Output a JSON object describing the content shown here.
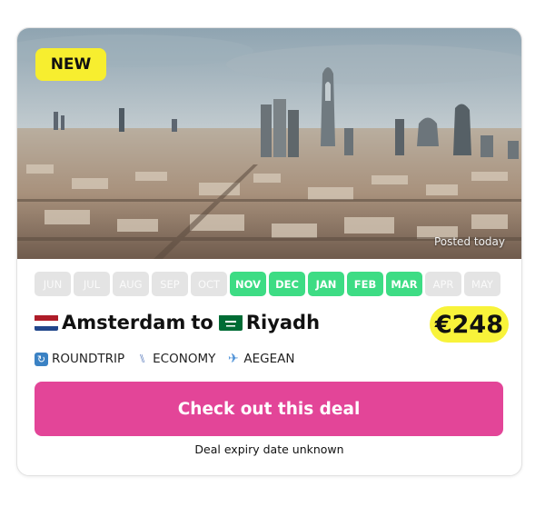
{
  "badge": "NEW",
  "posted": "Posted today",
  "months": [
    {
      "label": "JUN",
      "active": false
    },
    {
      "label": "JUL",
      "active": false
    },
    {
      "label": "AUG",
      "active": false
    },
    {
      "label": "SEP",
      "active": false
    },
    {
      "label": "OCT",
      "active": false
    },
    {
      "label": "NOV",
      "active": true
    },
    {
      "label": "DEC",
      "active": true
    },
    {
      "label": "JAN",
      "active": true
    },
    {
      "label": "FEB",
      "active": true
    },
    {
      "label": "MAR",
      "active": true
    },
    {
      "label": "APR",
      "active": false
    },
    {
      "label": "MAY",
      "active": false
    }
  ],
  "route": {
    "origin": "Amsterdam",
    "connector": "to",
    "destination": "Riyadh",
    "origin_flag": "netherlands-flag",
    "destination_flag": "saudi-arabia-flag"
  },
  "price": "€248",
  "meta": {
    "trip_type": "ROUNDTRIP",
    "cabin": "ECONOMY",
    "airline": "AEGEAN"
  },
  "cta": "Check out this deal",
  "expiry": "Deal expiry date unknown",
  "colors": {
    "accent_pink": "#e34598",
    "active_month": "#3ddc84",
    "inactive_month": "#e4e4e4",
    "highlight_yellow": "#f8f33a"
  }
}
